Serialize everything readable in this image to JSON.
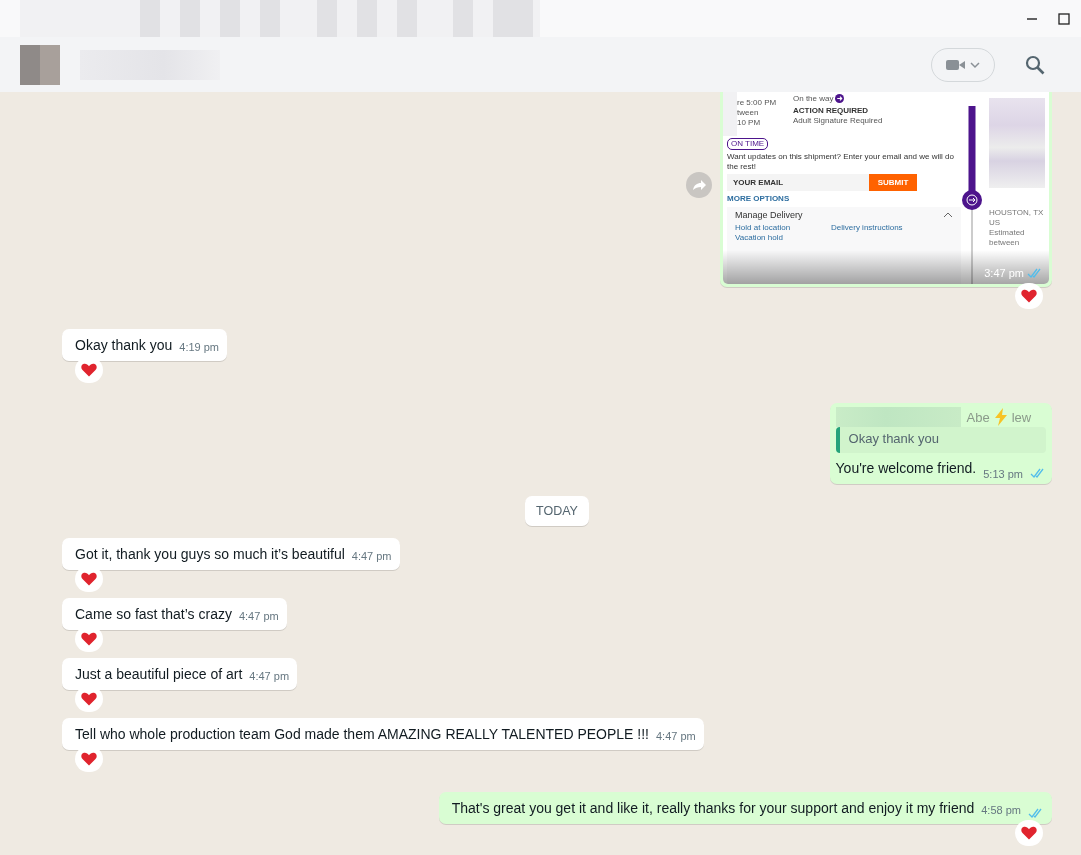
{
  "messages": [
    {
      "kind": "image",
      "outgoing": true,
      "time": "3:47 pm",
      "read": true,
      "reacted": true,
      "image": {
        "status": "On the way",
        "action_label": "ACTION REQUIRED",
        "action": "Adult Signature Required",
        "window_lines": [
          "re 5:00 PM",
          "tween",
          "10 PM"
        ],
        "badge": "ON TIME",
        "prompt": "Want updates on this shipment? Enter your email and we will do the rest!",
        "email_placeholder": "YOUR EMAIL",
        "submit": "SUBMIT",
        "more": "MORE OPTIONS",
        "panel_title": "Manage Delivery",
        "options": [
          "Hold at location",
          "Delivery instructions",
          "Vacation hold"
        ],
        "destination": "HOUSTON, TX US",
        "estimate": "Estimated between"
      }
    },
    {
      "kind": "text",
      "outgoing": false,
      "text": "Okay thank you",
      "time": "4:19 pm",
      "reacted": true
    },
    {
      "kind": "reply",
      "outgoing": true,
      "quote": {
        "author_start": "Abe",
        "author_end": "lew",
        "text": "Okay thank you"
      },
      "text": "You're welcome friend.",
      "time": "5:13 pm",
      "read": true,
      "reacted": false
    },
    {
      "kind": "divider",
      "label": "TODAY"
    },
    {
      "kind": "text",
      "outgoing": false,
      "text": "Got it, thank you guys so much it’s beautiful",
      "time": "4:47 pm",
      "reacted": true
    },
    {
      "kind": "text",
      "outgoing": false,
      "text": "Came so fast that’s crazy",
      "time": "4:47 pm",
      "reacted": true
    },
    {
      "kind": "text",
      "outgoing": false,
      "text": "Just a beautiful piece of art",
      "time": "4:47 pm",
      "reacted": true
    },
    {
      "kind": "text",
      "outgoing": false,
      "text": "Tell who whole production team God made them AMAZING REALLY TALENTED PEOPLE !!!",
      "time": "4:47 pm",
      "reacted": true
    },
    {
      "kind": "text",
      "outgoing": true,
      "text": "That's great you get it and like it, really thanks for your support and enjoy it my friend",
      "time": "4:58 pm",
      "read": true,
      "reacted": true
    }
  ]
}
